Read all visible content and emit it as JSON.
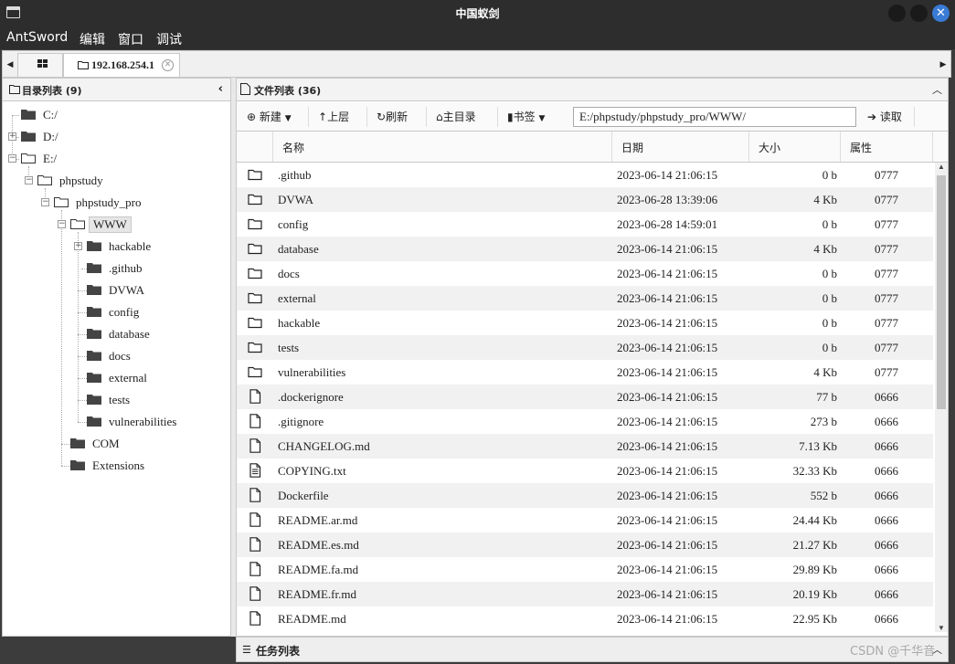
{
  "window": {
    "title": "中国蚁剑"
  },
  "menu": [
    "AntSword",
    "编辑",
    "窗口",
    "调试"
  ],
  "tabs": [
    {
      "label": ""
    },
    {
      "label": "192.168.254.1"
    }
  ],
  "left_panel": {
    "title": "目录列表 (9)"
  },
  "tree": {
    "drives": [
      "C:/",
      "D:/",
      "E:/"
    ],
    "phpstudy": "phpstudy",
    "phpstudy_pro": "phpstudy_pro",
    "www": "WWW",
    "www_children": [
      "hackable",
      ".github",
      "DVWA",
      "config",
      "database",
      "docs",
      "external",
      "tests",
      "vulnerabilities"
    ],
    "siblings": [
      "COM",
      "Extensions"
    ]
  },
  "right_panel": {
    "title": "文件列表 (36)"
  },
  "toolbar": {
    "new": "新建",
    "up": "上层",
    "refresh": "刷新",
    "home": "主目录",
    "bookmark": "书签",
    "path": "E:/phpstudy/phpstudy_pro/WWW/",
    "read": "读取"
  },
  "columns": [
    "名称",
    "日期",
    "大小",
    "属性"
  ],
  "files": [
    {
      "type": "folder",
      "name": ".github",
      "date": "2023-06-14 21:06:15",
      "size": "0 b",
      "attr": "0777"
    },
    {
      "type": "folder",
      "name": "DVWA",
      "date": "2023-06-28 13:39:06",
      "size": "4 Kb",
      "attr": "0777"
    },
    {
      "type": "folder",
      "name": "config",
      "date": "2023-06-28 14:59:01",
      "size": "0 b",
      "attr": "0777"
    },
    {
      "type": "folder",
      "name": "database",
      "date": "2023-06-14 21:06:15",
      "size": "4 Kb",
      "attr": "0777"
    },
    {
      "type": "folder",
      "name": "docs",
      "date": "2023-06-14 21:06:15",
      "size": "0 b",
      "attr": "0777"
    },
    {
      "type": "folder",
      "name": "external",
      "date": "2023-06-14 21:06:15",
      "size": "0 b",
      "attr": "0777"
    },
    {
      "type": "folder",
      "name": "hackable",
      "date": "2023-06-14 21:06:15",
      "size": "0 b",
      "attr": "0777"
    },
    {
      "type": "folder",
      "name": "tests",
      "date": "2023-06-14 21:06:15",
      "size": "0 b",
      "attr": "0777"
    },
    {
      "type": "folder",
      "name": "vulnerabilities",
      "date": "2023-06-14 21:06:15",
      "size": "4 Kb",
      "attr": "0777"
    },
    {
      "type": "file",
      "name": ".dockerignore",
      "date": "2023-06-14 21:06:15",
      "size": "77 b",
      "attr": "0666"
    },
    {
      "type": "file",
      "name": ".gitignore",
      "date": "2023-06-14 21:06:15",
      "size": "273 b",
      "attr": "0666"
    },
    {
      "type": "file",
      "name": "CHANGELOG.md",
      "date": "2023-06-14 21:06:15",
      "size": "7.13 Kb",
      "attr": "0666"
    },
    {
      "type": "text",
      "name": "COPYING.txt",
      "date": "2023-06-14 21:06:15",
      "size": "32.33 Kb",
      "attr": "0666"
    },
    {
      "type": "file",
      "name": "Dockerfile",
      "date": "2023-06-14 21:06:15",
      "size": "552 b",
      "attr": "0666"
    },
    {
      "type": "file",
      "name": "README.ar.md",
      "date": "2023-06-14 21:06:15",
      "size": "24.44 Kb",
      "attr": "0666"
    },
    {
      "type": "file",
      "name": "README.es.md",
      "date": "2023-06-14 21:06:15",
      "size": "21.27 Kb",
      "attr": "0666"
    },
    {
      "type": "file",
      "name": "README.fa.md",
      "date": "2023-06-14 21:06:15",
      "size": "29.89 Kb",
      "attr": "0666"
    },
    {
      "type": "file",
      "name": "README.fr.md",
      "date": "2023-06-14 21:06:15",
      "size": "20.19 Kb",
      "attr": "0666"
    },
    {
      "type": "file",
      "name": "README.md",
      "date": "2023-06-14 21:06:15",
      "size": "22.95 Kb",
      "attr": "0666"
    }
  ],
  "task_panel": {
    "title": "任务列表"
  },
  "watermark": "CSDN @千华音"
}
